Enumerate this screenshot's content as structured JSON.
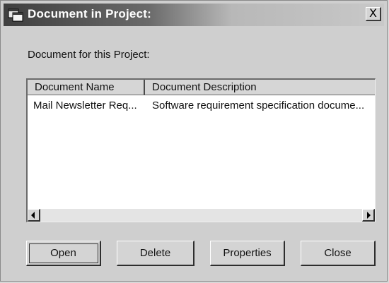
{
  "window": {
    "title": "Document in Project:",
    "close_glyph": "X"
  },
  "group": {
    "label": "Document for this Project:"
  },
  "list": {
    "columns": [
      "Document Name",
      "Document Description"
    ],
    "rows": [
      {
        "name": "Mail Newsletter Req...",
        "description": "Software requirement specification docume..."
      }
    ]
  },
  "buttons": {
    "open": "Open",
    "delete": "Delete",
    "properties": "Properties",
    "close": "Close"
  }
}
